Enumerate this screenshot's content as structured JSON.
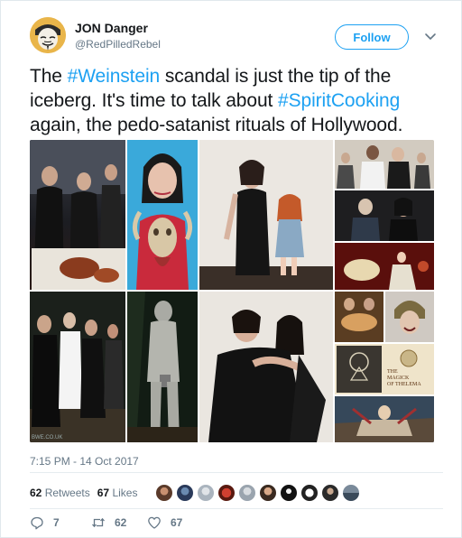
{
  "user": {
    "display_name": "JON Danger",
    "handle": "@RedPilledRebel",
    "avatar_icon": "avatar-mask-icon"
  },
  "follow_label": "Follow",
  "tweet": {
    "part1": "The ",
    "hashtag1": "#Weinstein",
    "part2": " scandal is just the tip of the iceberg. It's time to talk about ",
    "hashtag2": "#SpiritCooking",
    "part3": " again, the pedo-satanist rituals of Hollywood."
  },
  "media": {
    "watermark": "BWE.CO.UK",
    "book_title_line1": "THE",
    "book_title_line2": "MAGICK",
    "book_title_line3": "OF THELEMA"
  },
  "timestamp": "7:15 PM - 14 Oct 2017",
  "stats": {
    "retweets_count": "62",
    "retweets_label": "Retweets",
    "likes_count": "67",
    "likes_label": "Likes"
  },
  "actions": {
    "reply_count": "7",
    "retweet_count": "62",
    "like_count": "67"
  },
  "colors": {
    "accent": "#1da1f2",
    "muted": "#657786",
    "text": "#14171a"
  }
}
